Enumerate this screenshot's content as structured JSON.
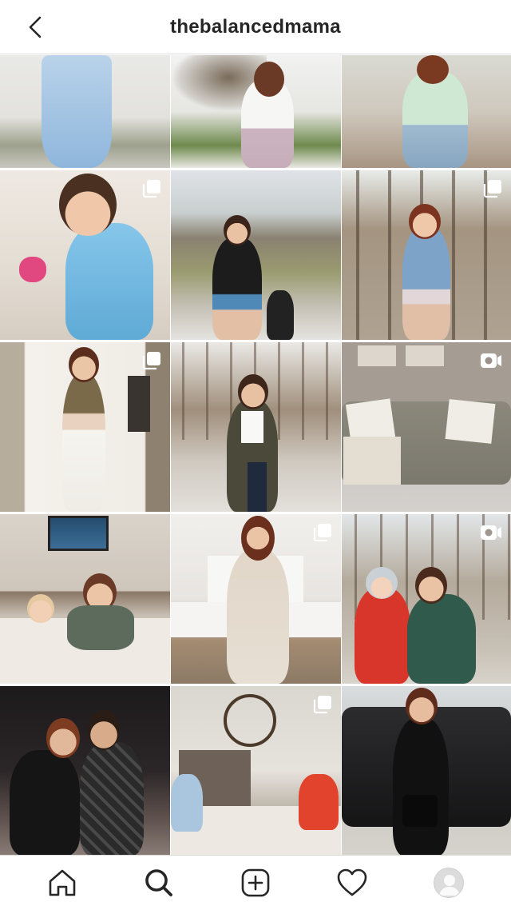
{
  "header": {
    "title": "thebalancedmama",
    "back_icon": "chevron-left-icon"
  },
  "grid": {
    "tiles": [
      {
        "desc": "woman-blue-dress",
        "badge": "none"
      },
      {
        "desc": "woman-white-top-tree",
        "badge": "none"
      },
      {
        "desc": "woman-green-top-shorts",
        "badge": "none"
      },
      {
        "desc": "boy-blue-shirt",
        "badge": "carousel"
      },
      {
        "desc": "mom-daughter-walk",
        "badge": "none"
      },
      {
        "desc": "woman-denim-jacket-woods",
        "badge": "carousel"
      },
      {
        "desc": "woman-mirror-selfie",
        "badge": "carousel"
      },
      {
        "desc": "woman-green-coat-woods",
        "badge": "none"
      },
      {
        "desc": "sofa-living-room",
        "badge": "video"
      },
      {
        "desc": "mom-kid-bed",
        "badge": "none"
      },
      {
        "desc": "woman-bedroom-cream",
        "badge": "carousel"
      },
      {
        "desc": "mom-kid-red-coat",
        "badge": "video"
      },
      {
        "desc": "couple-night",
        "badge": "none"
      },
      {
        "desc": "kids-table-chandelier",
        "badge": "carousel"
      },
      {
        "desc": "woman-black-car",
        "badge": "none"
      }
    ]
  },
  "nav": {
    "items": [
      "home-icon",
      "search-icon",
      "add-post-icon",
      "heart-icon",
      "profile-avatar"
    ]
  }
}
